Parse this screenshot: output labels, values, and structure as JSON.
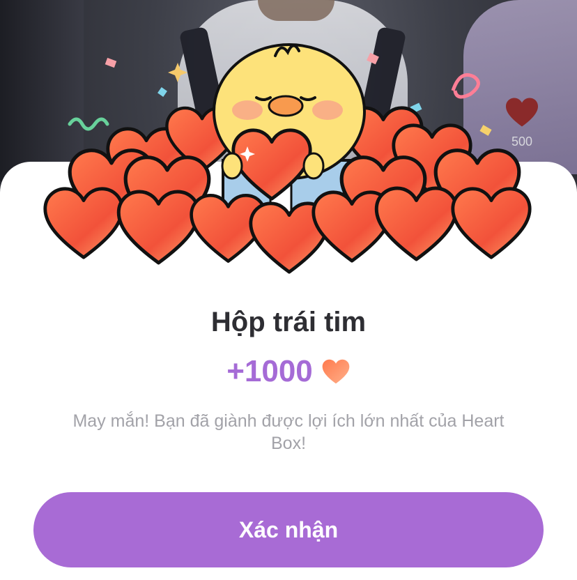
{
  "side_panel": {
    "like_count": "500",
    "like_icon": "heart-icon"
  },
  "popup": {
    "title": "Hộp trái tim",
    "reward_amount": "+1000",
    "reward_icon": "heart-icon",
    "description": "May mắn! Bạn đã giành được lợi ích lớn nhất của Heart Box!",
    "confirm_label": "Xác nhận",
    "illustration": "chick-holding-heart-in-heart-pile"
  },
  "colors": {
    "accent": "#a86bd5",
    "reward_text": "#a56bd6",
    "title_text": "#2e2e33",
    "description_text": "#a2a2a8",
    "heart_red": "#f25a3c"
  }
}
